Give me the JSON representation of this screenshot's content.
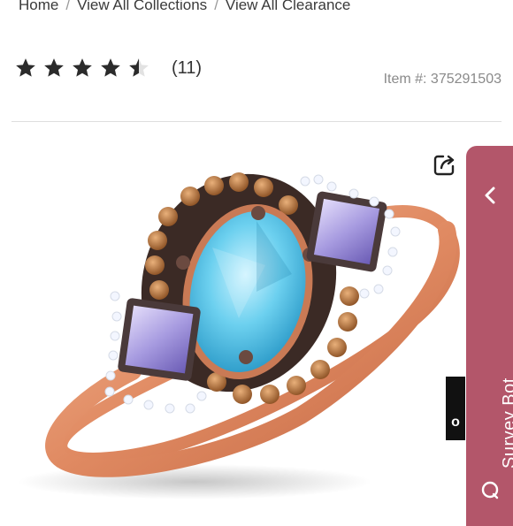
{
  "breadcrumb": {
    "items": [
      "Home",
      "View All Collections",
      "View All Clearance"
    ],
    "separator": "/"
  },
  "rating": {
    "value": 4.5,
    "max": 5,
    "count_label": "(11)"
  },
  "item": {
    "number_label": "Item #: 375291503"
  },
  "product_image": {
    "description_icon": "ring-image"
  },
  "survey_bot": {
    "label": "Survey Bot",
    "color": "#b3566a"
  },
  "edge_button": {
    "label": "o"
  },
  "colors": {
    "star": "#2b2b2b",
    "text": "#3a3a3a",
    "muted": "#8a8a8a"
  }
}
